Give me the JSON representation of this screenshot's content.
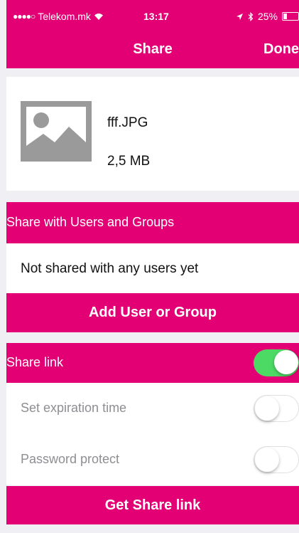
{
  "status": {
    "carrier": "Telekom.mk",
    "time": "13:17",
    "battery": "25%",
    "battery_level": 0.25
  },
  "nav": {
    "title": "Share",
    "done_label": "Done"
  },
  "file": {
    "name": "fff.JPG",
    "size": "2,5 MB",
    "thumbnail_icon": "image-placeholder-icon"
  },
  "users_section": {
    "header": "Share with Users and Groups",
    "empty_text": "Not shared with any users yet",
    "add_button": "Add User or Group"
  },
  "link_section": {
    "header": "Share link",
    "share_link_enabled": true,
    "options": [
      {
        "label": "Set expiration time",
        "enabled": false
      },
      {
        "label": "Password protect",
        "enabled": false
      }
    ],
    "get_link_button": "Get Share link"
  },
  "colors": {
    "accent": "#e20074",
    "toggle_on": "#4cd964",
    "background": "#efeff4"
  }
}
